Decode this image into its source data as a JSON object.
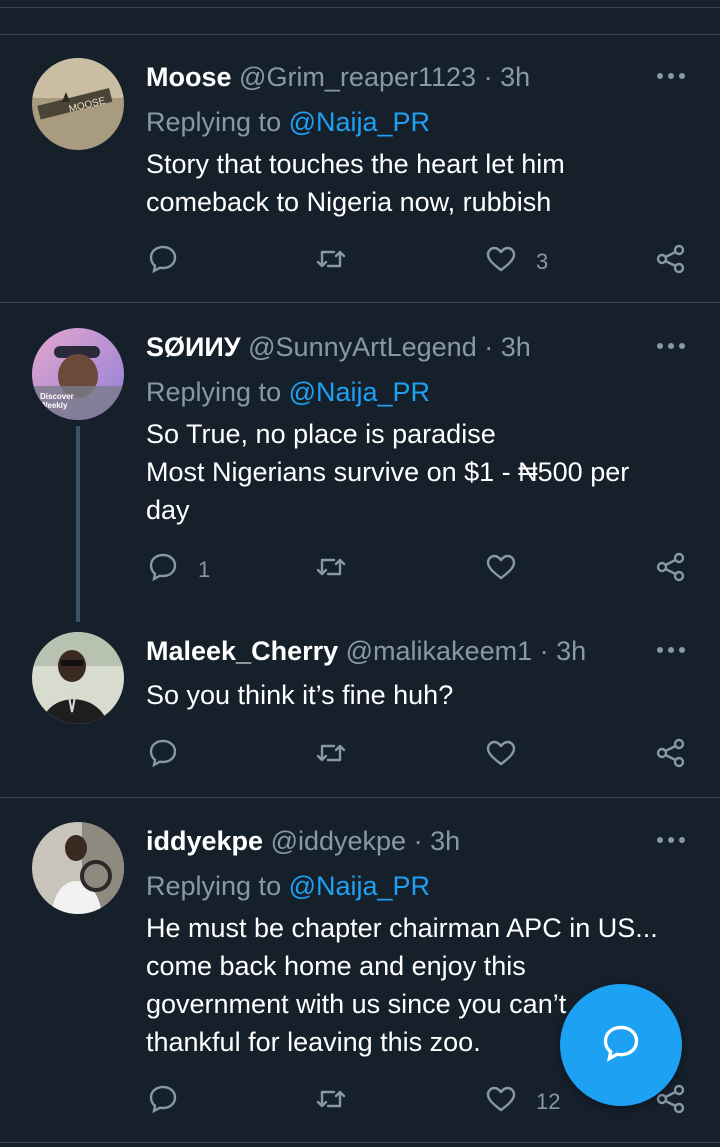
{
  "tweets": [
    {
      "name": "Moose",
      "handle": "@Grim_reaper1123",
      "dot": "·",
      "time": "3h",
      "replying_prefix": "Replying to ",
      "replying_to": "@Naija_PR",
      "lines": [
        "Story that touches the heart let him",
        "comeback to Nigeria now, rubbish"
      ],
      "reply_count": "",
      "retweet_count": "",
      "like_count": "3"
    },
    {
      "name": "SØИИУ",
      "handle": "@SunnyArtLegend",
      "dot": "·",
      "time": "3h",
      "replying_prefix": "Replying to ",
      "replying_to": "@Naija_PR",
      "lines": [
        "So True, no place is  paradise",
        "Most Nigerians survive on $1 - ₦500 per",
        "day"
      ],
      "avatar_text": [
        "Discover",
        "Weekly"
      ],
      "reply_count": "1",
      "retweet_count": "",
      "like_count": ""
    },
    {
      "name": "Maleek_Cherry",
      "handle": "@malikakeem1",
      "dot": "·",
      "time": "3h",
      "lines": [
        "So you think it’s fine huh?"
      ],
      "reply_count": "",
      "retweet_count": "",
      "like_count": ""
    },
    {
      "name": "iddyekpe",
      "handle": "@iddyekpe",
      "dot": "·",
      "time": "3h",
      "replying_prefix": "Replying to ",
      "replying_to": "@Naija_PR",
      "lines": [
        "He must be chapter chairman APC in US...",
        "come back home and enjoy this",
        "government with us since you can’t",
        "thankful for leaving this zoo."
      ],
      "reply_count": "",
      "retweet_count": "",
      "like_count": "12"
    }
  ],
  "icons": {
    "more": "more-horizontal-icon",
    "reply": "reply-bubble-icon",
    "retweet": "retweet-icon",
    "like": "heart-icon",
    "share": "share-icon",
    "compose": "compose-reply-icon"
  },
  "colors": {
    "background": "#15202b",
    "divider": "#38444d",
    "muted": "#8899a6",
    "accent": "#1da1f2"
  }
}
